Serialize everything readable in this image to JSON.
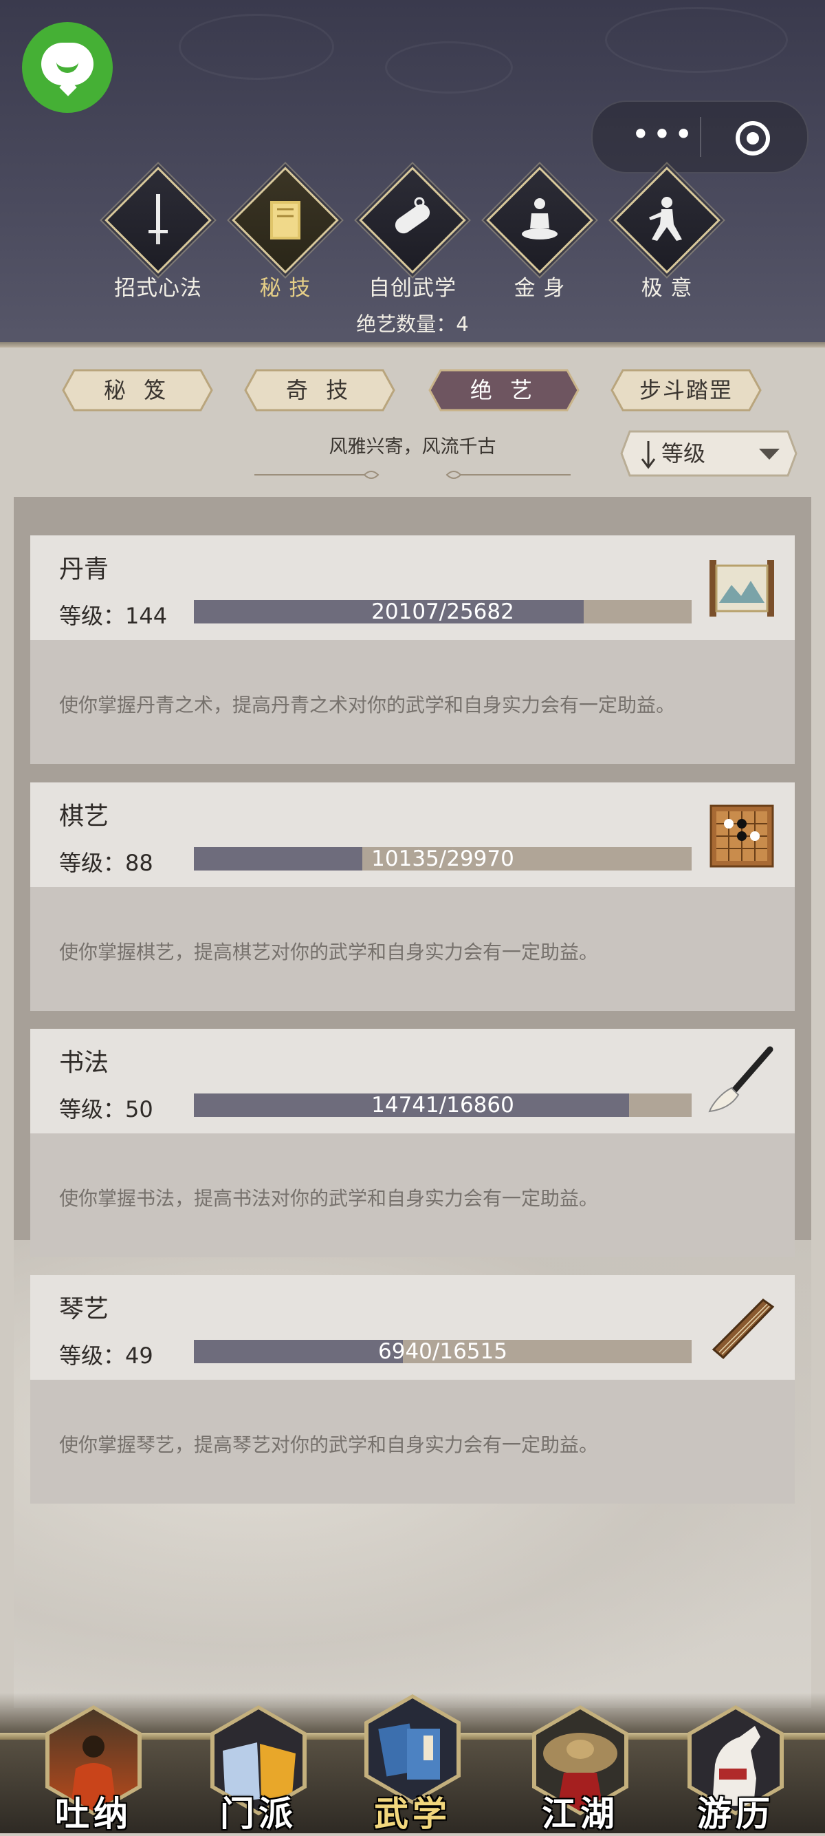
{
  "top_categories": [
    {
      "label": "招式心法",
      "icon": "sword-icon",
      "active": false
    },
    {
      "label": "秘 技",
      "icon": "book-icon",
      "active": true
    },
    {
      "label": "自创武学",
      "icon": "scroll-icon",
      "active": false
    },
    {
      "label": "金 身",
      "icon": "meditation-icon",
      "active": false
    },
    {
      "label": "极 意",
      "icon": "martial-stance-icon",
      "active": false
    }
  ],
  "count_text": "绝艺数量：4",
  "sub_tabs": [
    {
      "label": "秘 笈",
      "active": false
    },
    {
      "label": "奇 技",
      "active": false
    },
    {
      "label": "绝 艺",
      "active": true
    },
    {
      "label": "步斗踏罡",
      "active": false
    }
  ],
  "subtitle": "风雅兴寄，风流千古",
  "sort": {
    "label": "等级",
    "direction_icon": "arrow-down-icon",
    "dropdown_icon": "triangle-down-icon"
  },
  "skills": [
    {
      "name": "丹青",
      "level_text": "等级：144",
      "progress_text": "20107/25682",
      "progress": 0.783,
      "description": "使你掌握丹青之术，提高丹青之术对你的武学和自身实力会有一定助益。",
      "icon": "painting-scroll-icon"
    },
    {
      "name": "棋艺",
      "level_text": "等级：88",
      "progress_text": "10135/29970",
      "progress": 0.338,
      "description": "使你掌握棋艺，提高棋艺对你的武学和自身实力会有一定助益。",
      "icon": "go-board-icon"
    },
    {
      "name": "书法",
      "level_text": "等级：50",
      "progress_text": "14741/16860",
      "progress": 0.874,
      "description": "使你掌握书法，提高书法对你的武学和自身实力会有一定助益。",
      "icon": "calligraphy-brush-icon"
    },
    {
      "name": "琴艺",
      "level_text": "等级：49",
      "progress_text": "6940/16515",
      "progress": 0.42,
      "description": "使你掌握琴艺，提高琴艺对你的武学和自身实力会有一定助益。",
      "icon": "guqin-icon"
    }
  ],
  "bottom_nav": [
    {
      "label": "吐纳",
      "icon": "monk-icon",
      "active": false
    },
    {
      "label": "门派",
      "icon": "sect-flags-icon",
      "active": false
    },
    {
      "label": "武学",
      "icon": "martial-books-icon",
      "active": true
    },
    {
      "label": "江湖",
      "icon": "straw-hat-icon",
      "active": false
    },
    {
      "label": "游历",
      "icon": "white-horse-icon",
      "active": false
    }
  ],
  "colors": {
    "header_bg": "#4b4b5e",
    "gold": "#d8c89a",
    "active_tab": "#6e5560",
    "bar_fill": "#6e6c7c",
    "bar_bg": "#b0a597"
  }
}
